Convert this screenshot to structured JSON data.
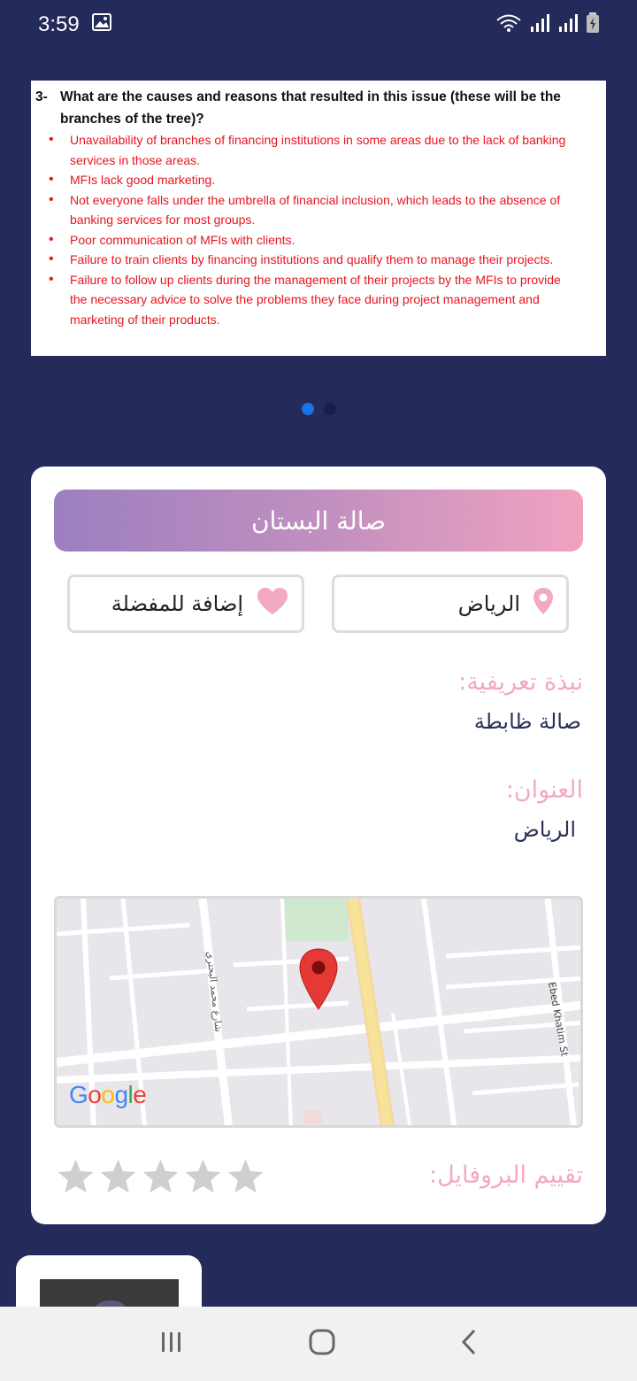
{
  "status": {
    "time": "3:59"
  },
  "slide": {
    "question_number": "3-",
    "question": "What are the causes and reasons that resulted in this issue (these will be the branches of the tree)?",
    "bullets": [
      "Unavailability of branches of financing institutions in some areas due to the lack of banking services in those areas.",
      "MFIs lack good marketing.",
      "Not everyone falls under the umbrella of financial inclusion, which leads to the absence of banking services for most groups.",
      "Poor communication of MFIs with clients.",
      "Failure to train clients by financing institutions and qualify them to manage their projects.",
      "Failure to follow up clients during the management of their projects by the MFIs to provide the necessary advice to solve the problems they face during project management and marketing of their products."
    ]
  },
  "venue": {
    "name": "صالة البستان",
    "location": "الرياض",
    "favorite_label": "إضافة للمفضلة",
    "bio_label": "نبذة تعريفية:",
    "bio_value": "صالة ظابطة",
    "address_label": "العنوان:",
    "address_value": "الرياض",
    "rating_label": "تقييم البروفايل:",
    "rating": 0,
    "rating_max": 5
  },
  "map": {
    "street_left": "شارع محمد البحتري",
    "street_right": "Ebed Khatim St",
    "logo": "Google"
  },
  "colors": {
    "background": "#242a5a",
    "accent_pink": "#f2aac4",
    "gradient_start": "#9c7fc0",
    "gradient_end": "#f0a3c0",
    "dot_active": "#1a73e8",
    "bullet_red": "#e8141e"
  }
}
